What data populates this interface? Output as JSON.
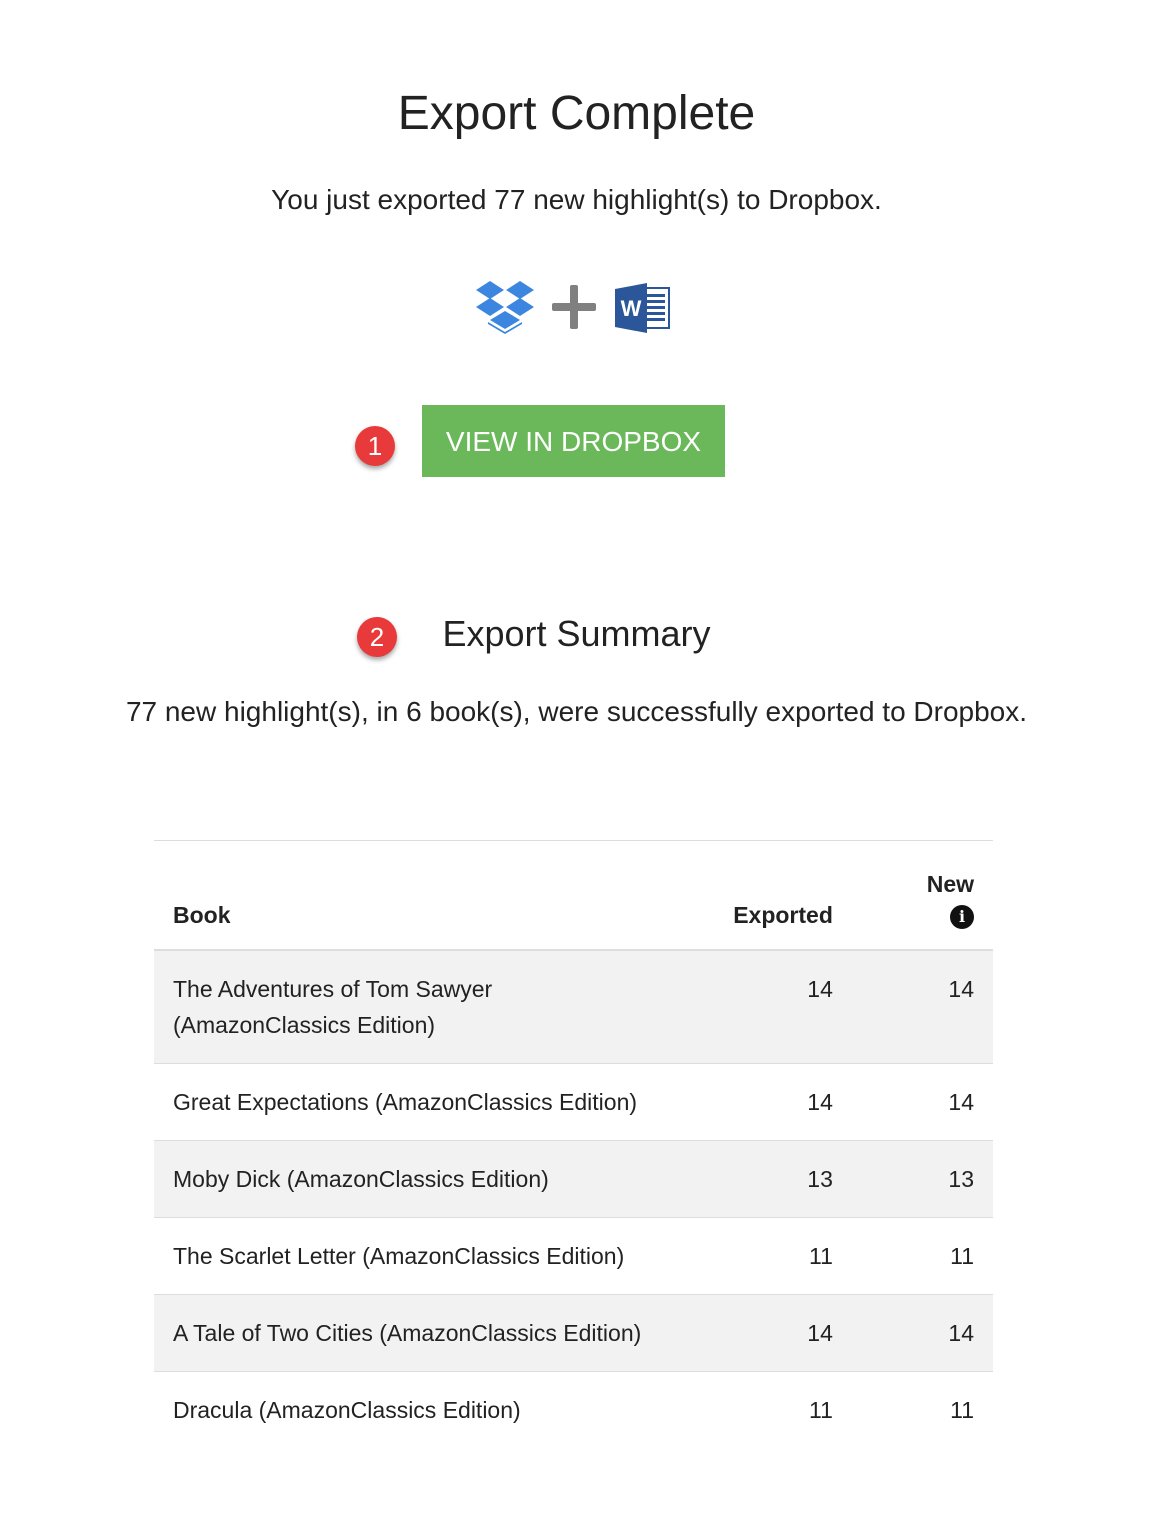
{
  "page": {
    "title": "Export Complete",
    "subtitle": "You just exported 77 new highlight(s) to Dropbox."
  },
  "icons": [
    "dropbox-icon",
    "plus-icon",
    "word-icon"
  ],
  "callouts": {
    "first": "1",
    "second": "2"
  },
  "actions": {
    "view_label": "VIEW IN DROPBOX"
  },
  "summary": {
    "title": "Export Summary",
    "text": "77 new highlight(s), in 6 book(s), were successfully exported to Dropbox."
  },
  "table": {
    "headers": {
      "book": "Book",
      "exported": "Exported",
      "new": "New"
    },
    "rows": [
      {
        "book": "The Adventures of Tom Sawyer (AmazonClassics Edition)",
        "exported": "14",
        "new": "14"
      },
      {
        "book": "Great Expectations (AmazonClassics Edition)",
        "exported": "14",
        "new": "14"
      },
      {
        "book": "Moby Dick (AmazonClassics Edition)",
        "exported": "13",
        "new": "13"
      },
      {
        "book": "The Scarlet Letter (AmazonClassics Edition)",
        "exported": "11",
        "new": "11"
      },
      {
        "book": "A Tale of Two Cities (AmazonClassics Edition)",
        "exported": "14",
        "new": "14"
      },
      {
        "book": "Dracula (AmazonClassics Edition)",
        "exported": "11",
        "new": "11"
      }
    ]
  },
  "colors": {
    "button": "#6bb85b",
    "callout": "#e83a3a",
    "dropbox": "#3d86e0",
    "word": "#2b579a",
    "stripe": "#f2f2f2"
  }
}
